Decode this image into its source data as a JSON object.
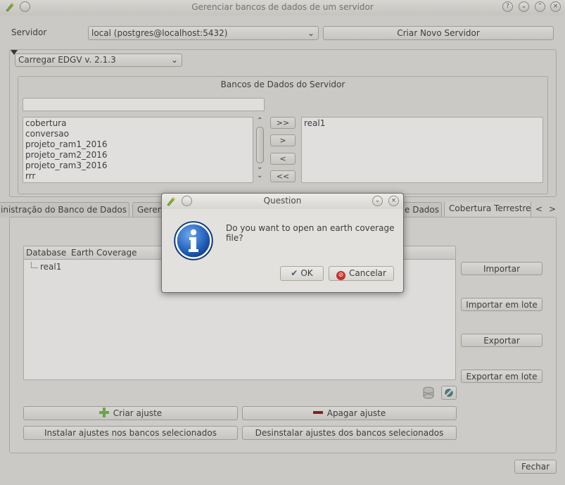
{
  "window": {
    "title": "Gerenciar bancos de dados de um servidor"
  },
  "server": {
    "label": "Servidor",
    "selected": "local (postgres@localhost:5432)",
    "create_button": "Criar Novo Servidor"
  },
  "edgv": {
    "selected": "Carregar EDGV v. 2.1.3"
  },
  "databases": {
    "title": "Bancos de Dados do Servidor",
    "filter_value": "",
    "available": [
      "cobertura",
      "conversao",
      "projeto_ram1_2016",
      "projeto_ram2_2016",
      "projeto_ram3_2016",
      "rrr"
    ],
    "selected": [
      "real1"
    ],
    "move_all_right": ">>",
    "move_right": ">",
    "move_left": "<",
    "move_all_left": "<<"
  },
  "tabs": [
    {
      "label": "inistração do Banco de Dados"
    },
    {
      "label": "Geren"
    },
    {
      "label": "e Dados"
    },
    {
      "label": "Cobertura Terrestre"
    }
  ],
  "tab_nav": {
    "prev": "<",
    "next": ">"
  },
  "coverage": {
    "columns": [
      "Database",
      "Earth Coverage"
    ],
    "tree": [
      {
        "label": "real1"
      }
    ],
    "import": "Importar",
    "import_batch": "Importar em lote",
    "export": "Exportar",
    "export_batch": "Exportar em lote"
  },
  "settings": {
    "create": "Criar ajuste",
    "delete": "Apagar ajuste",
    "install": "Instalar ajustes nos bancos selecionados",
    "uninstall": "Desinstalar ajustes dos bancos selecionados"
  },
  "close_button": "Fechar",
  "dialog": {
    "title": "Question",
    "message": "Do you want to open an earth coverage file?",
    "ok": "OK",
    "cancel": "Cancelar"
  },
  "colors": {
    "info_blue": "#1f5db8",
    "cancel_red": "#c8302b",
    "create_green": "#6cb33f",
    "delete_red": "#8b1a1a"
  }
}
